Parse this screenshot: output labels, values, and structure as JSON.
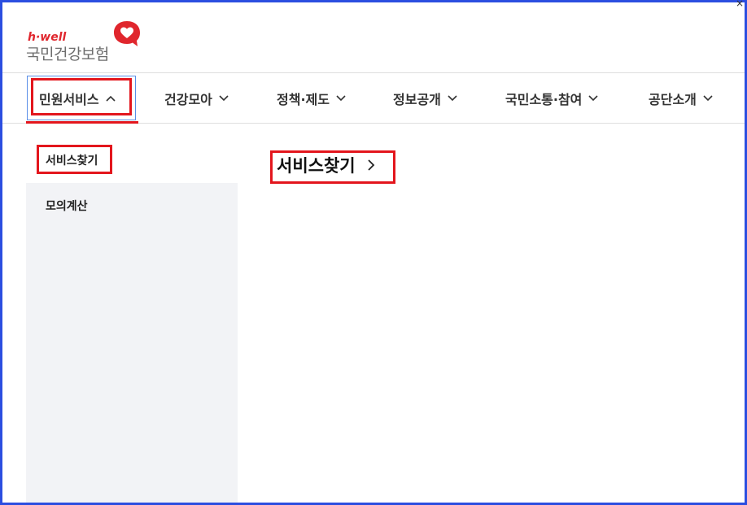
{
  "window": {
    "close_glyph": "×"
  },
  "logo": {
    "small_text": "h·well",
    "main_text": "국민건강보험",
    "icon": "heart-speech-icon",
    "brand_color": "#e0262d"
  },
  "nav": {
    "items": [
      {
        "label": "민원서비스",
        "state": "expanded",
        "icon": "chevron-up-icon"
      },
      {
        "label": "건강모아",
        "icon": "chevron-down-icon"
      },
      {
        "label": "정책·제도",
        "icon": "chevron-down-icon"
      },
      {
        "label": "정보공개",
        "icon": "chevron-down-icon"
      },
      {
        "label": "국민소통·참여",
        "icon": "chevron-down-icon"
      },
      {
        "label": "공단소개",
        "icon": "chevron-down-icon"
      }
    ]
  },
  "sidebar": {
    "items": [
      {
        "label": "서비스찾기",
        "selected": true
      },
      {
        "label": "모의계산",
        "selected": false
      }
    ]
  },
  "main": {
    "title": "서비스찾기",
    "icon": "chevron-right-icon"
  },
  "colors": {
    "highlight_red": "#e3161d",
    "frame_blue": "#2b4ee0",
    "sidebar_bg": "#f2f3f6"
  }
}
